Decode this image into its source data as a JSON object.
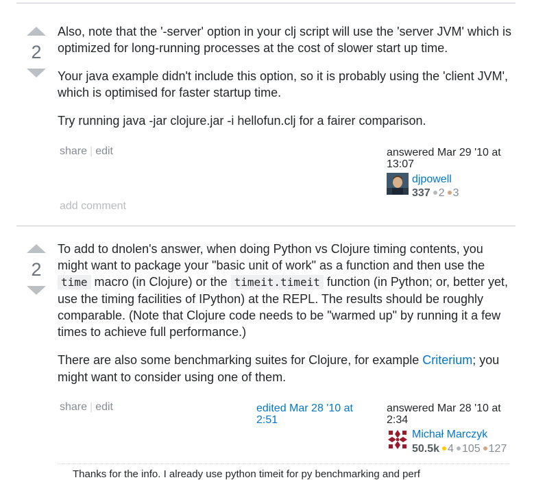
{
  "answers": [
    {
      "votes": "2",
      "paragraphs": [
        "Also, note that the '-server' option in your clj script will use the 'server JVM' which is optimized for long-running processes at the cost of slower start up time.",
        "Your java example didn't include this option, so it is probably using the 'client JVM', which is optimised for faster startup time.",
        "Try running java -jar clojure.jar -i hellofun.clj for a fairer comparison."
      ],
      "share": "share",
      "edit": "edit",
      "answered_line1": "answered Mar 29 '10 at",
      "answered_line2": "13:07",
      "user": "djpowell",
      "rep": "337",
      "silver": "2",
      "bronze": "3",
      "add_comment": "add comment"
    },
    {
      "votes": "2",
      "p1_a": "To add to dnolen's answer, when doing Python vs Clojure timing contents, you might want to package your \"basic unit of work\" as a function and then use the ",
      "code1": "time",
      "p1_b": " macro (in Clojure) or the ",
      "code2": "timeit.timeit",
      "p1_c": " function (in Python; or, better yet, use the timing facilities of IPython) at the REPL. The results should be roughly comparable. (Note that Clojure code needs to be \"warmed up\" by running it a few times to achieve full performance.)",
      "p2_a": "There are also some benchmarking suites for Clojure, for example ",
      "p2_link": "Criterium",
      "p2_b": "; you might want to consider using one of them.",
      "share": "share",
      "edit": "edit",
      "edited_line1": "edited Mar 28 '10 at",
      "edited_line2": "2:51",
      "answered_line1": "answered Mar 28 '10 at",
      "answered_line2": "2:34",
      "user": "Michał Marczyk",
      "rep": "50.5k",
      "gold": "4",
      "silver": "105",
      "bronze": "127",
      "comment_preview": "Thanks for the info. I already use python timeit for py benchmarking and perf"
    }
  ]
}
